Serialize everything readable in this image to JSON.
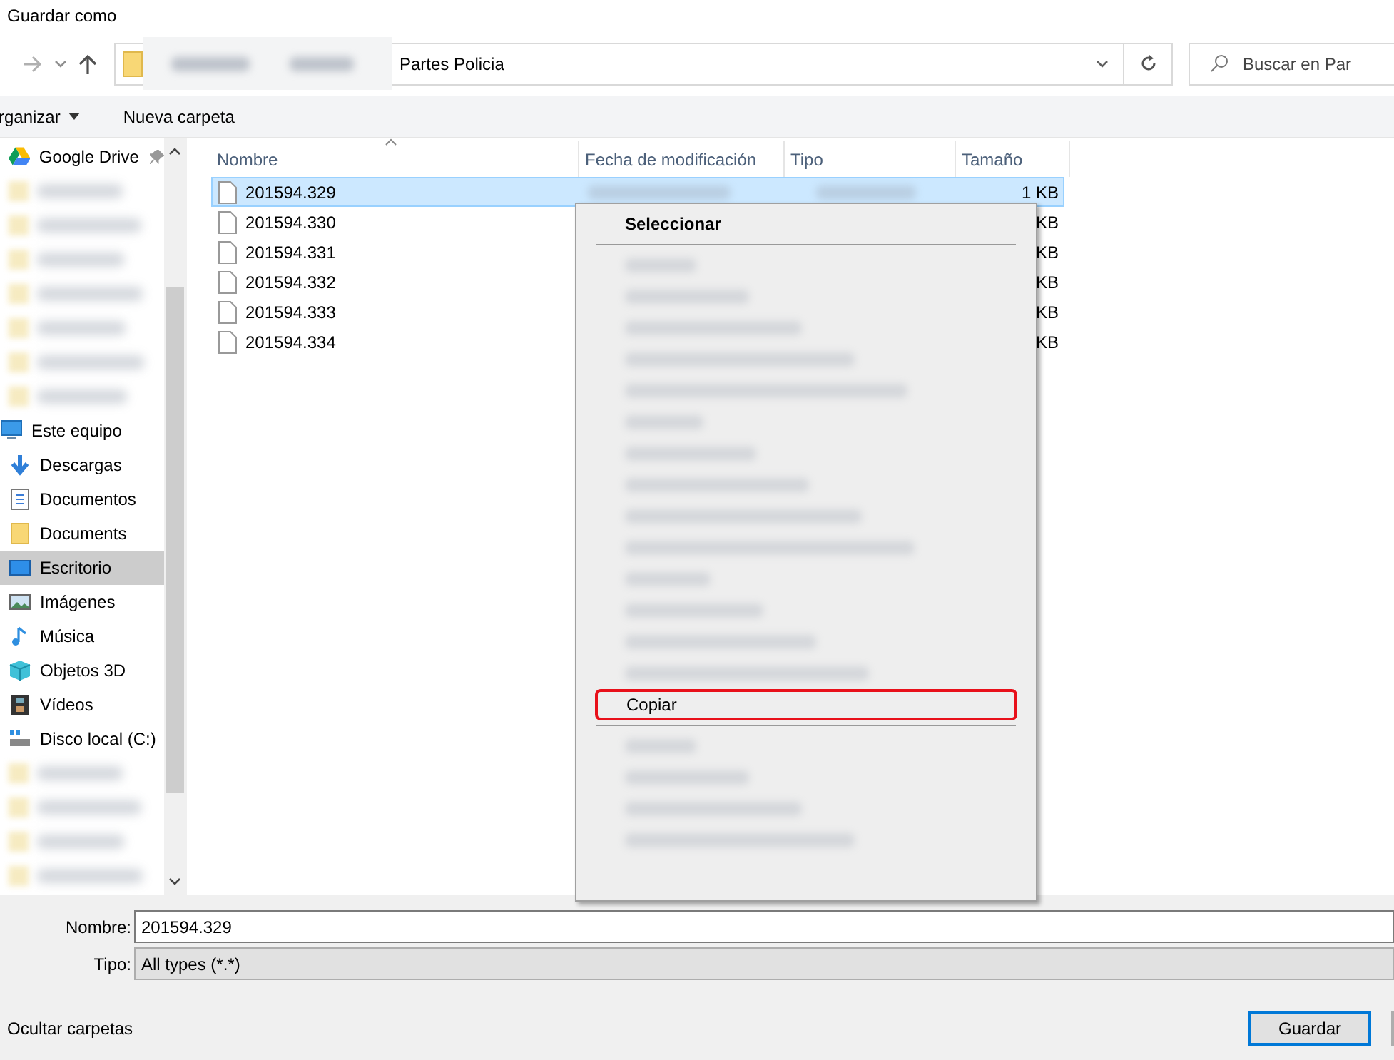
{
  "window": {
    "title": "Guardar como"
  },
  "address_bar": {
    "path": "Partes Policia"
  },
  "search": {
    "placeholder": "Buscar en Par"
  },
  "toolbar": {
    "organize": "rganizar",
    "new_folder": "Nueva carpeta"
  },
  "sidebar": {
    "items": [
      {
        "label": "Google Drive",
        "kind": "gdrive",
        "pinned": true,
        "selected": false
      },
      {
        "label": "Este equipo",
        "kind": "pc",
        "pinned": false,
        "selected": false
      },
      {
        "label": "Descargas",
        "kind": "downloads",
        "pinned": false,
        "selected": false
      },
      {
        "label": "Documentos",
        "kind": "documents",
        "pinned": false,
        "selected": false
      },
      {
        "label": "Documents",
        "kind": "folder",
        "pinned": false,
        "selected": false
      },
      {
        "label": "Escritorio",
        "kind": "desktop",
        "pinned": false,
        "selected": true
      },
      {
        "label": "Imágenes",
        "kind": "pictures",
        "pinned": false,
        "selected": false
      },
      {
        "label": "Música",
        "kind": "music",
        "pinned": false,
        "selected": false
      },
      {
        "label": "Objetos 3D",
        "kind": "objects",
        "pinned": false,
        "selected": false
      },
      {
        "label": "Vídeos",
        "kind": "videos",
        "pinned": false,
        "selected": false
      },
      {
        "label": "Disco local (C:)",
        "kind": "drive",
        "pinned": false,
        "selected": false
      }
    ]
  },
  "table": {
    "columns": [
      "Nombre",
      "Fecha de modificación",
      "Tipo",
      "Tamaño"
    ],
    "rows": [
      {
        "name": "201594.329",
        "size": "1 KB",
        "selected": true
      },
      {
        "name": "201594.330",
        "size": "KB",
        "selected": false
      },
      {
        "name": "201594.331",
        "size": "KB",
        "selected": false
      },
      {
        "name": "201594.332",
        "size": "KB",
        "selected": false
      },
      {
        "name": "201594.333",
        "size": "KB",
        "selected": false
      },
      {
        "name": "201594.334",
        "size": "KB",
        "selected": false
      }
    ]
  },
  "context_menu": {
    "items": [
      {
        "label": "Seleccionar",
        "default": true,
        "outlined": false
      },
      {
        "label": "Copiar",
        "default": false,
        "outlined": true
      }
    ]
  },
  "form": {
    "name_label": "Nombre:",
    "name_value": "201594.329",
    "type_label": "Tipo:",
    "type_value": "All types (*.*)"
  },
  "footer": {
    "hide_folders": "Ocultar carpetas",
    "save_button": "Guardar"
  }
}
